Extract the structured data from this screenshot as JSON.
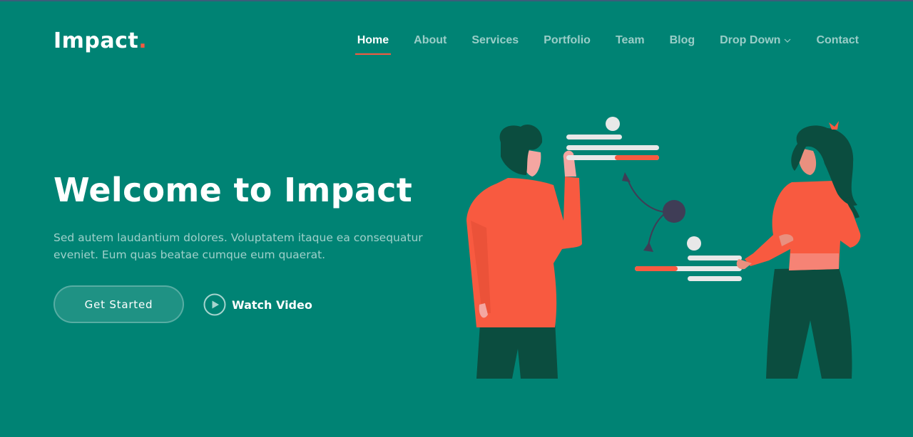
{
  "brand": {
    "name": "Impact",
    "dot": "."
  },
  "nav": {
    "items": [
      {
        "label": "Home",
        "active": true
      },
      {
        "label": "About"
      },
      {
        "label": "Services"
      },
      {
        "label": "Portfolio"
      },
      {
        "label": "Team"
      },
      {
        "label": "Blog"
      },
      {
        "label": "Drop Down",
        "has_dropdown": true
      },
      {
        "label": "Contact"
      }
    ]
  },
  "hero": {
    "title": "Welcome to Impact",
    "text": "Sed autem laudantium dolores. Voluptatem itaque ea consequatur eveniet. Eum quas beatae cumque eum quaerat.",
    "primary_button": "Get Started",
    "video_button": "Watch Video"
  },
  "colors": {
    "background": "#008374",
    "accent": "#f85a40",
    "text": "#ffffff",
    "person_dark": "#0b4d3f",
    "shirt": "#f85a40"
  },
  "icons": {
    "play": "play-circle-icon",
    "dropdown": "chevron-down-icon"
  }
}
